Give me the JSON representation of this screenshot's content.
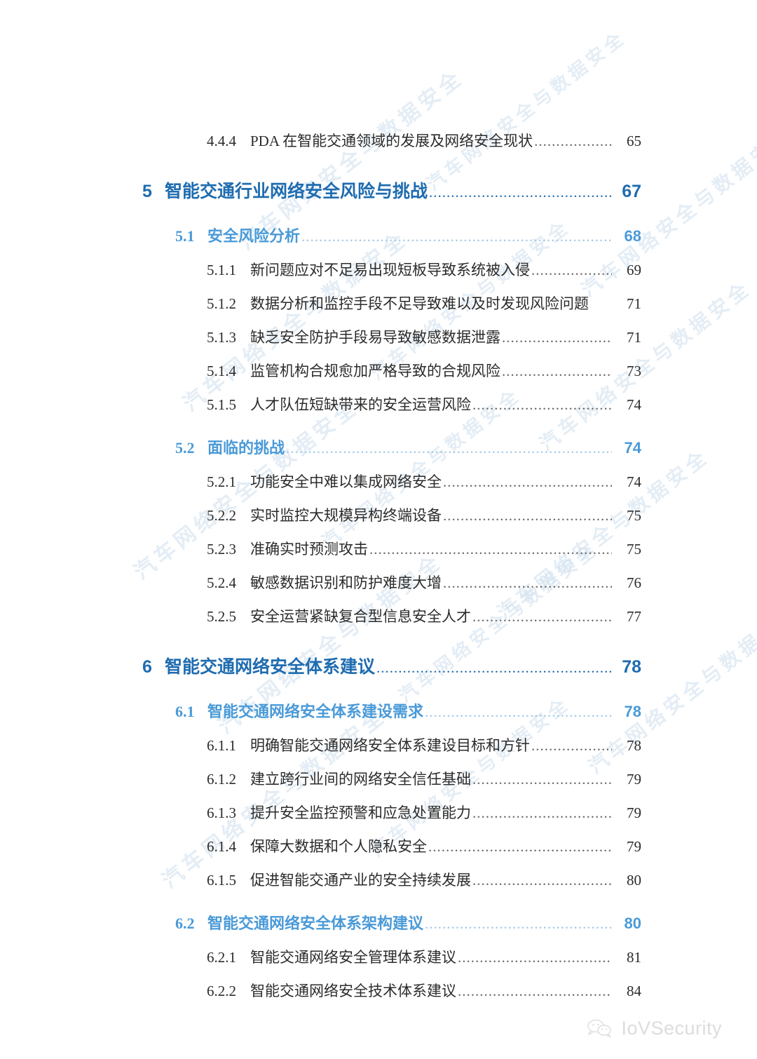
{
  "document": {
    "type": "table-of-contents",
    "language": "zh-CN"
  },
  "toc": {
    "entries": [
      {
        "level": 3,
        "number": "4.4.4",
        "title": "PDA 在智能交通领域的发展及网络安全现状",
        "page": "65",
        "leader": true
      },
      {
        "level": 1,
        "number": "5",
        "title": "智能交通行业网络安全风险与挑战",
        "page": "67",
        "leader": true
      },
      {
        "level": 2,
        "number": "5.1",
        "title": "安全风险分析",
        "page": "68",
        "leader": true
      },
      {
        "level": 3,
        "number": "5.1.1",
        "title": "新问题应对不足易出现短板导致系统被入侵",
        "page": "69",
        "leader": true
      },
      {
        "level": 3,
        "number": "5.1.2",
        "title": "数据分析和监控手段不足导致难以及时发现风险问题",
        "page": "71",
        "leader": false
      },
      {
        "level": 3,
        "number": "5.1.3",
        "title": "缺乏安全防护手段易导致敏感数据泄露",
        "page": "71",
        "leader": true
      },
      {
        "level": 3,
        "number": "5.1.4",
        "title": "监管机构合规愈加严格导致的合规风险",
        "page": "73",
        "leader": true
      },
      {
        "level": 3,
        "number": "5.1.5",
        "title": "人才队伍短缺带来的安全运营风险",
        "page": "74",
        "leader": true
      },
      {
        "level": 2,
        "number": "5.2",
        "title": "面临的挑战",
        "page": "74",
        "leader": true
      },
      {
        "level": 3,
        "number": "5.2.1",
        "title": "功能安全中难以集成网络安全",
        "page": "74",
        "leader": true
      },
      {
        "level": 3,
        "number": "5.2.2",
        "title": "实时监控大规模异构终端设备",
        "page": "75",
        "leader": true
      },
      {
        "level": 3,
        "number": "5.2.3",
        "title": "准确实时预测攻击",
        "page": "75",
        "leader": true
      },
      {
        "level": 3,
        "number": "5.2.4",
        "title": "敏感数据识别和防护难度大增",
        "page": "76",
        "leader": true
      },
      {
        "level": 3,
        "number": "5.2.5",
        "title": "安全运营紧缺复合型信息安全人才",
        "page": "77",
        "leader": true
      },
      {
        "level": 1,
        "number": "6",
        "title": "智能交通网络安全体系建议",
        "page": "78",
        "leader": true
      },
      {
        "level": 2,
        "number": "6.1",
        "title": "智能交通网络安全体系建设需求",
        "page": "78",
        "leader": true
      },
      {
        "level": 3,
        "number": "6.1.1",
        "title": "明确智能交通网络安全体系建设目标和方针",
        "page": "78",
        "leader": true
      },
      {
        "level": 3,
        "number": "6.1.2",
        "title": "建立跨行业间的网络安全信任基础",
        "page": "79",
        "leader": true
      },
      {
        "level": 3,
        "number": "6.1.3",
        "title": "提升安全监控预警和应急处置能力",
        "page": "79",
        "leader": true
      },
      {
        "level": 3,
        "number": "6.1.4",
        "title": "保障大数据和个人隐私安全",
        "page": "79",
        "leader": true
      },
      {
        "level": 3,
        "number": "6.1.5",
        "title": "促进智能交通产业的安全持续发展",
        "page": "80",
        "leader": true
      },
      {
        "level": 2,
        "number": "6.2",
        "title": "智能交通网络安全体系架构建议",
        "page": "80",
        "leader": true
      },
      {
        "level": 3,
        "number": "6.2.1",
        "title": "智能交通网络安全管理体系建议",
        "page": "81",
        "leader": true
      },
      {
        "level": 3,
        "number": "6.2.2",
        "title": "智能交通网络安全技术体系建议",
        "page": "84",
        "leader": true
      }
    ]
  },
  "footer": {
    "brand": "IoVSecurity",
    "icon": "wechat-icon"
  },
  "watermark": {
    "text": "汽车网络安全与数据安全",
    "repeat": 14
  },
  "colors": {
    "level1": "#1f6cb0",
    "level2": "#4a9ad8",
    "level3": "#2b2b2b",
    "background": "#ffffff",
    "watermark": "#cfe0ee"
  }
}
